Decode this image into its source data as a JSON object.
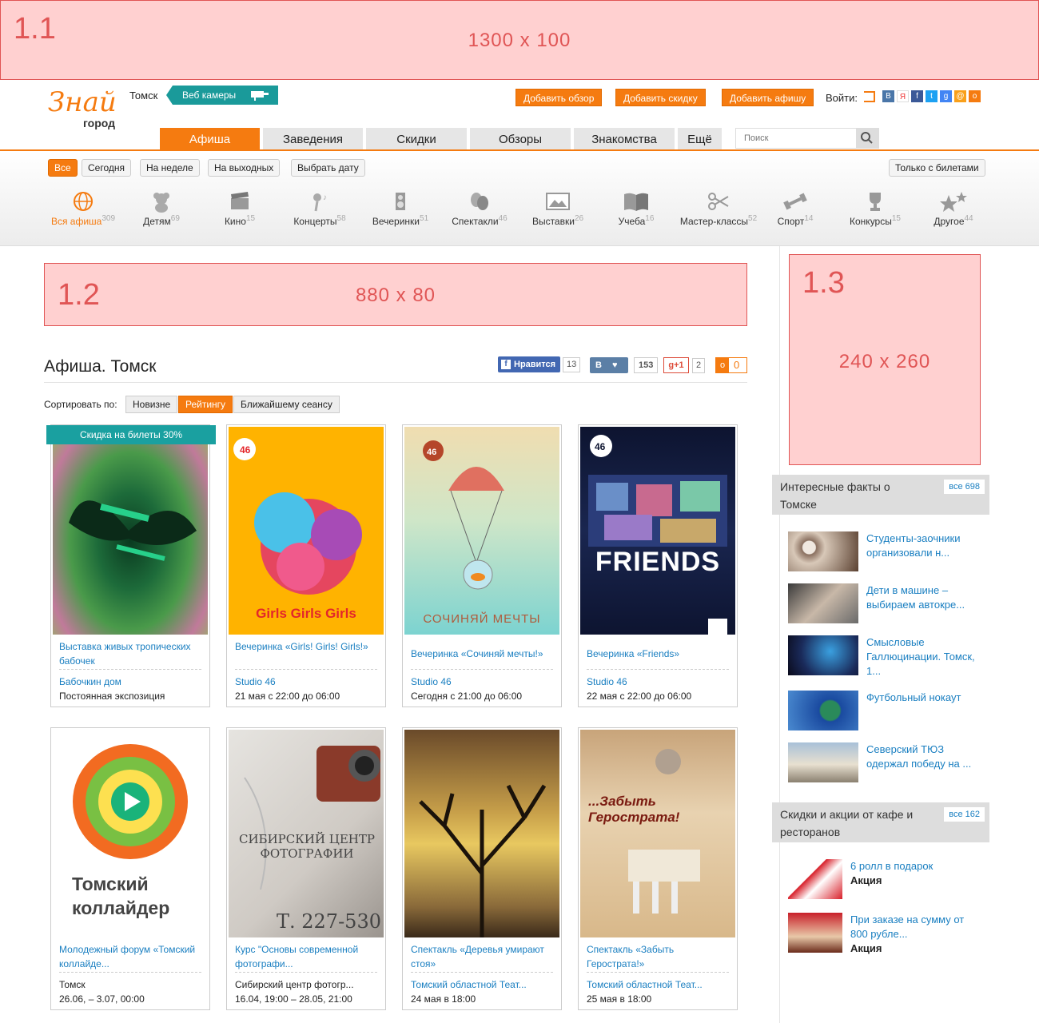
{
  "ads": {
    "a1": {
      "label": "1.1",
      "size": "1300 x 100"
    },
    "a2": {
      "label": "1.2",
      "size": "880 x 80"
    },
    "a3": {
      "label": "1.3",
      "size": "240 x 260"
    }
  },
  "header": {
    "logo_top": "Знай",
    "logo_bottom": "город",
    "city": "Томск",
    "webcam": "Веб камеры",
    "buttons": [
      "Добавить обзор",
      "Добавить скидку",
      "Добавить афишу"
    ],
    "login": "Войти:",
    "social": [
      "В",
      "Я",
      "f",
      "t",
      "g",
      "@",
      "о"
    ]
  },
  "nav": {
    "tabs": [
      "Афиша",
      "Заведения",
      "Скидки",
      "Обзоры",
      "Знакомства",
      "Ещё"
    ],
    "search_placeholder": "Поиск"
  },
  "filters": {
    "dates": [
      "Все",
      "Сегодня",
      "На неделе",
      "На выходных",
      "Выбрать дату"
    ],
    "tickets_only": "Только с билетами"
  },
  "categories": [
    {
      "name": "Вся афиша",
      "count": "309",
      "icon": "globe-icon"
    },
    {
      "name": "Детям",
      "count": "69",
      "icon": "teddy-bear-icon"
    },
    {
      "name": "Кино",
      "count": "15",
      "icon": "clapperboard-icon"
    },
    {
      "name": "Концерты",
      "count": "58",
      "icon": "microphone-icon"
    },
    {
      "name": "Вечеринки",
      "count": "51",
      "icon": "speaker-icon"
    },
    {
      "name": "Спектакли",
      "count": "46",
      "icon": "theatre-masks-icon"
    },
    {
      "name": "Выставки",
      "count": "26",
      "icon": "picture-icon"
    },
    {
      "name": "Учеба",
      "count": "16",
      "icon": "book-icon"
    },
    {
      "name": "Мастер-классы",
      "count": "52",
      "icon": "scissors-icon"
    },
    {
      "name": "Спорт",
      "count": "14",
      "icon": "dumbbell-icon"
    },
    {
      "name": "Конкурсы",
      "count": "15",
      "icon": "trophy-icon"
    },
    {
      "name": "Другое",
      "count": "44",
      "icon": "stars-icon"
    }
  ],
  "page": {
    "title": "Афиша. Томск",
    "likes": {
      "fb_label": "Нравится",
      "fb_count": "13",
      "vk_label": "В",
      "vk_count": "153",
      "gplus": "+1",
      "gplus_count": "2",
      "ok_count": "0"
    }
  },
  "sort": {
    "label": "Сортировать по:",
    "options": [
      "Новизне",
      "Рейтингу",
      "Ближайшему сеансу"
    ]
  },
  "events": [
    {
      "title": "Выставка живых тропических бабочек",
      "venue": "Бабочкин дом",
      "date": "Постоянная экспозиция",
      "badge": "Скидка на билеты 30%"
    },
    {
      "title": "Вечеринка «Girls! Girls! Girls!»",
      "venue": "Studio 46",
      "date": "21 мая с 22:00 до 06:00",
      "poster_text": "Girls Girls Girls"
    },
    {
      "title": "Вечеринка «Сочиняй мечты!»",
      "venue": "Studio 46",
      "date": "Сегодня с 21:00 до 06:00",
      "poster_text": "СОЧИНЯЙ МЕЧТЫ"
    },
    {
      "title": "Вечеринка «Friends»",
      "venue": "Studio 46",
      "date": "22 мая с 22:00 до 06:00",
      "poster_text": "FRIENDS"
    },
    {
      "title": "Молодежный форум «Томский коллайде...",
      "venue": "Томск",
      "date": "26.06, – 3.07, 00:00",
      "poster_text": "Томский коллайдер"
    },
    {
      "title": "Курс \"Основы современной фотографи...",
      "venue": "Сибирский центр фотогр...",
      "date": "16.04, 19:00 – 28.05, 21:00",
      "poster_text": "СИБИРСКИЙ ЦЕНТР ФОТОГРАФИИ",
      "poster_phone": "Т. 227-530"
    },
    {
      "title": "Спектакль «Деревья умирают стоя»",
      "venue": "Томский областной Теат...",
      "date": "24 мая в 18:00"
    },
    {
      "title": "Спектакль «Забыть Герострата!»",
      "venue": "Томский областной Теат...",
      "date": "25 мая в 18:00",
      "poster_text": "...Забыть Герострата!"
    }
  ],
  "sidebar": {
    "facts_title": "Интересные факты о Томске",
    "facts_all": "все 698",
    "facts": [
      "Студенты-заочники организовали н...",
      "Дети в машине – выбираем автокре...",
      "Смысловые Галлюцинации. Томск, 1...",
      "Футбольный нокаут",
      "Северский ТЮЗ одержал победу на ..."
    ],
    "promo_title": "Скидки и акции от кафе и ресторанов",
    "promo_all": "все 162",
    "promos": [
      {
        "title": "6 ролл в подарок",
        "type": "Акция"
      },
      {
        "title": "При заказе на сумму от 800 рубле...",
        "type": "Акция"
      }
    ]
  }
}
